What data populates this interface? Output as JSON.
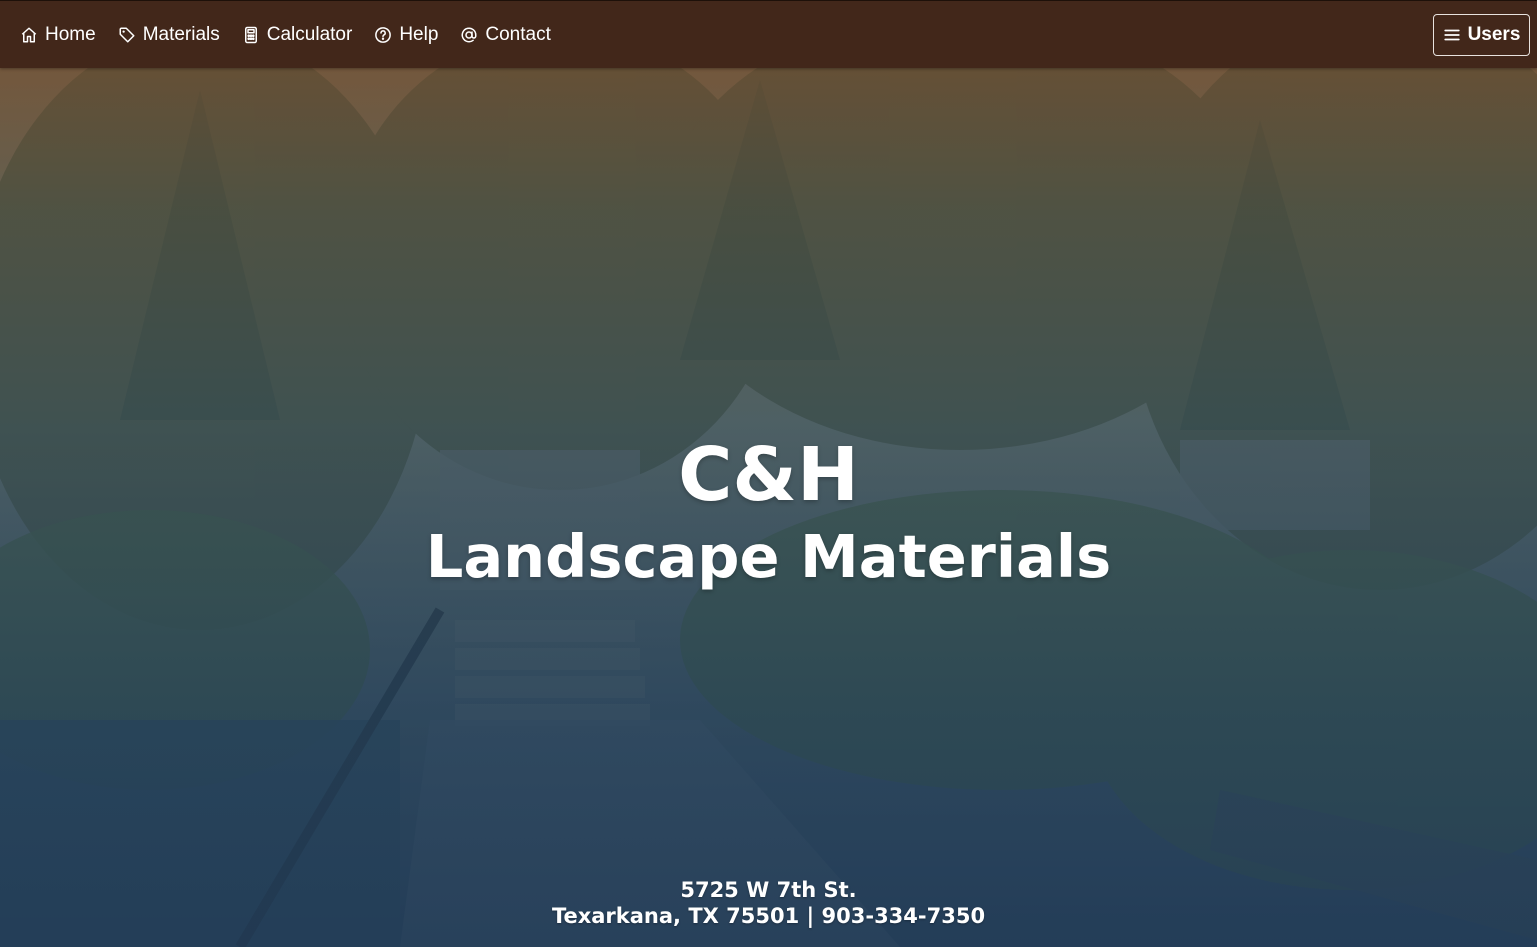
{
  "nav": {
    "items": [
      {
        "label": "Home",
        "icon": "home-icon"
      },
      {
        "label": "Materials",
        "icon": "tag-icon"
      },
      {
        "label": "Calculator",
        "icon": "calculator-icon"
      },
      {
        "label": "Help",
        "icon": "help-circle-icon"
      },
      {
        "label": "Contact",
        "icon": "at-sign-icon"
      }
    ],
    "users_button": {
      "label": "Users",
      "icon": "menu-icon"
    }
  },
  "hero": {
    "title": "C&H",
    "subtitle": "Landscape Materials",
    "address_line1": "5725 W 7th St.",
    "address_line2": "Texarkana, TX 75501 | 903-334-7350",
    "background_description_colors": {
      "nav_bg": "#42271a",
      "overlay_top": "#7a4e2c",
      "overlay_bottom": "#223c58"
    }
  }
}
